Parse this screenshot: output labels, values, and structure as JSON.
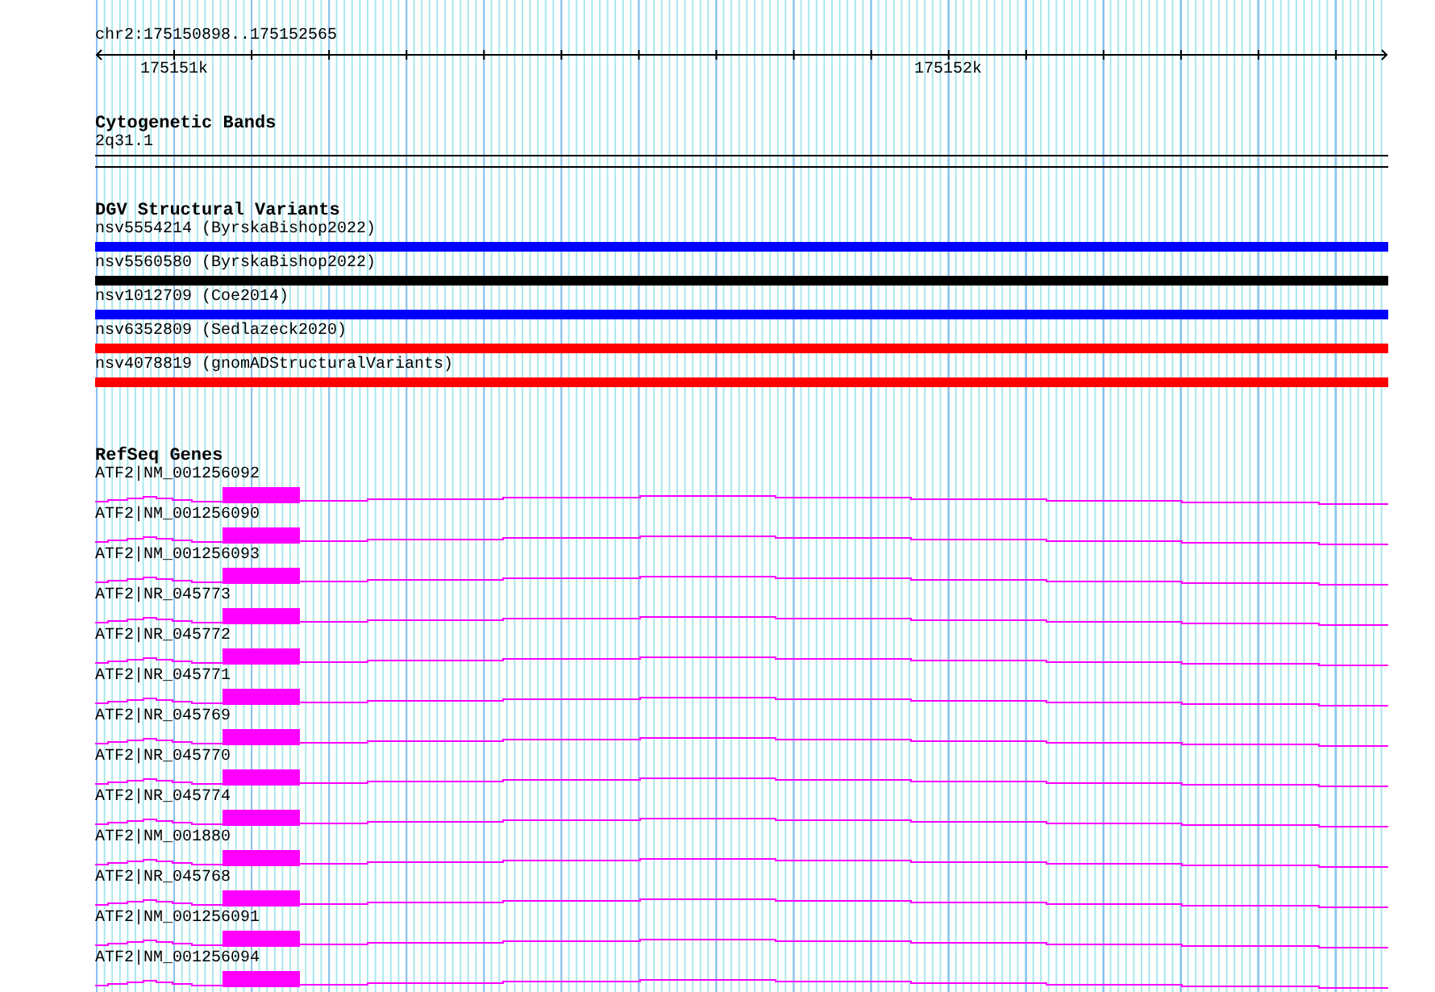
{
  "ruler": {
    "location": "chr2:175150898..175152565",
    "tick_labels": [
      "175151k",
      "175152k"
    ]
  },
  "tracks": [
    {
      "kind": "cytoband",
      "title": "Cytogenetic Bands",
      "features": [
        {
          "label": "2q31.1"
        }
      ]
    },
    {
      "kind": "variants",
      "title": "DGV Structural Variants",
      "features": [
        {
          "label": "nsv5554214 (ByrskaBishop2022)",
          "color": "#0000ff"
        },
        {
          "label": "nsv5560580 (ByrskaBishop2022)",
          "color": "#000000"
        },
        {
          "label": "nsv1012709 (Coe2014)",
          "color": "#0000ff"
        },
        {
          "label": "nsv6352809 (Sedlazeck2020)",
          "color": "#ff0000"
        },
        {
          "label": "nsv4078819 (gnomADStructuralVariants)",
          "color": "#ff0000"
        }
      ]
    },
    {
      "kind": "genes",
      "title": "RefSeq Genes",
      "features": [
        {
          "label": "ATF2|NM_001256092"
        },
        {
          "label": "ATF2|NM_001256090"
        },
        {
          "label": "ATF2|NM_001256093"
        },
        {
          "label": "ATF2|NR_045773"
        },
        {
          "label": "ATF2|NR_045772"
        },
        {
          "label": "ATF2|NR_045771"
        },
        {
          "label": "ATF2|NR_045769"
        },
        {
          "label": "ATF2|NR_045770"
        },
        {
          "label": "ATF2|NR_045774"
        },
        {
          "label": "ATF2|NM_001880"
        },
        {
          "label": "ATF2|NR_045768"
        },
        {
          "label": "ATF2|NM_001256091"
        },
        {
          "label": "ATF2|NM_001256094"
        }
      ]
    }
  ]
}
